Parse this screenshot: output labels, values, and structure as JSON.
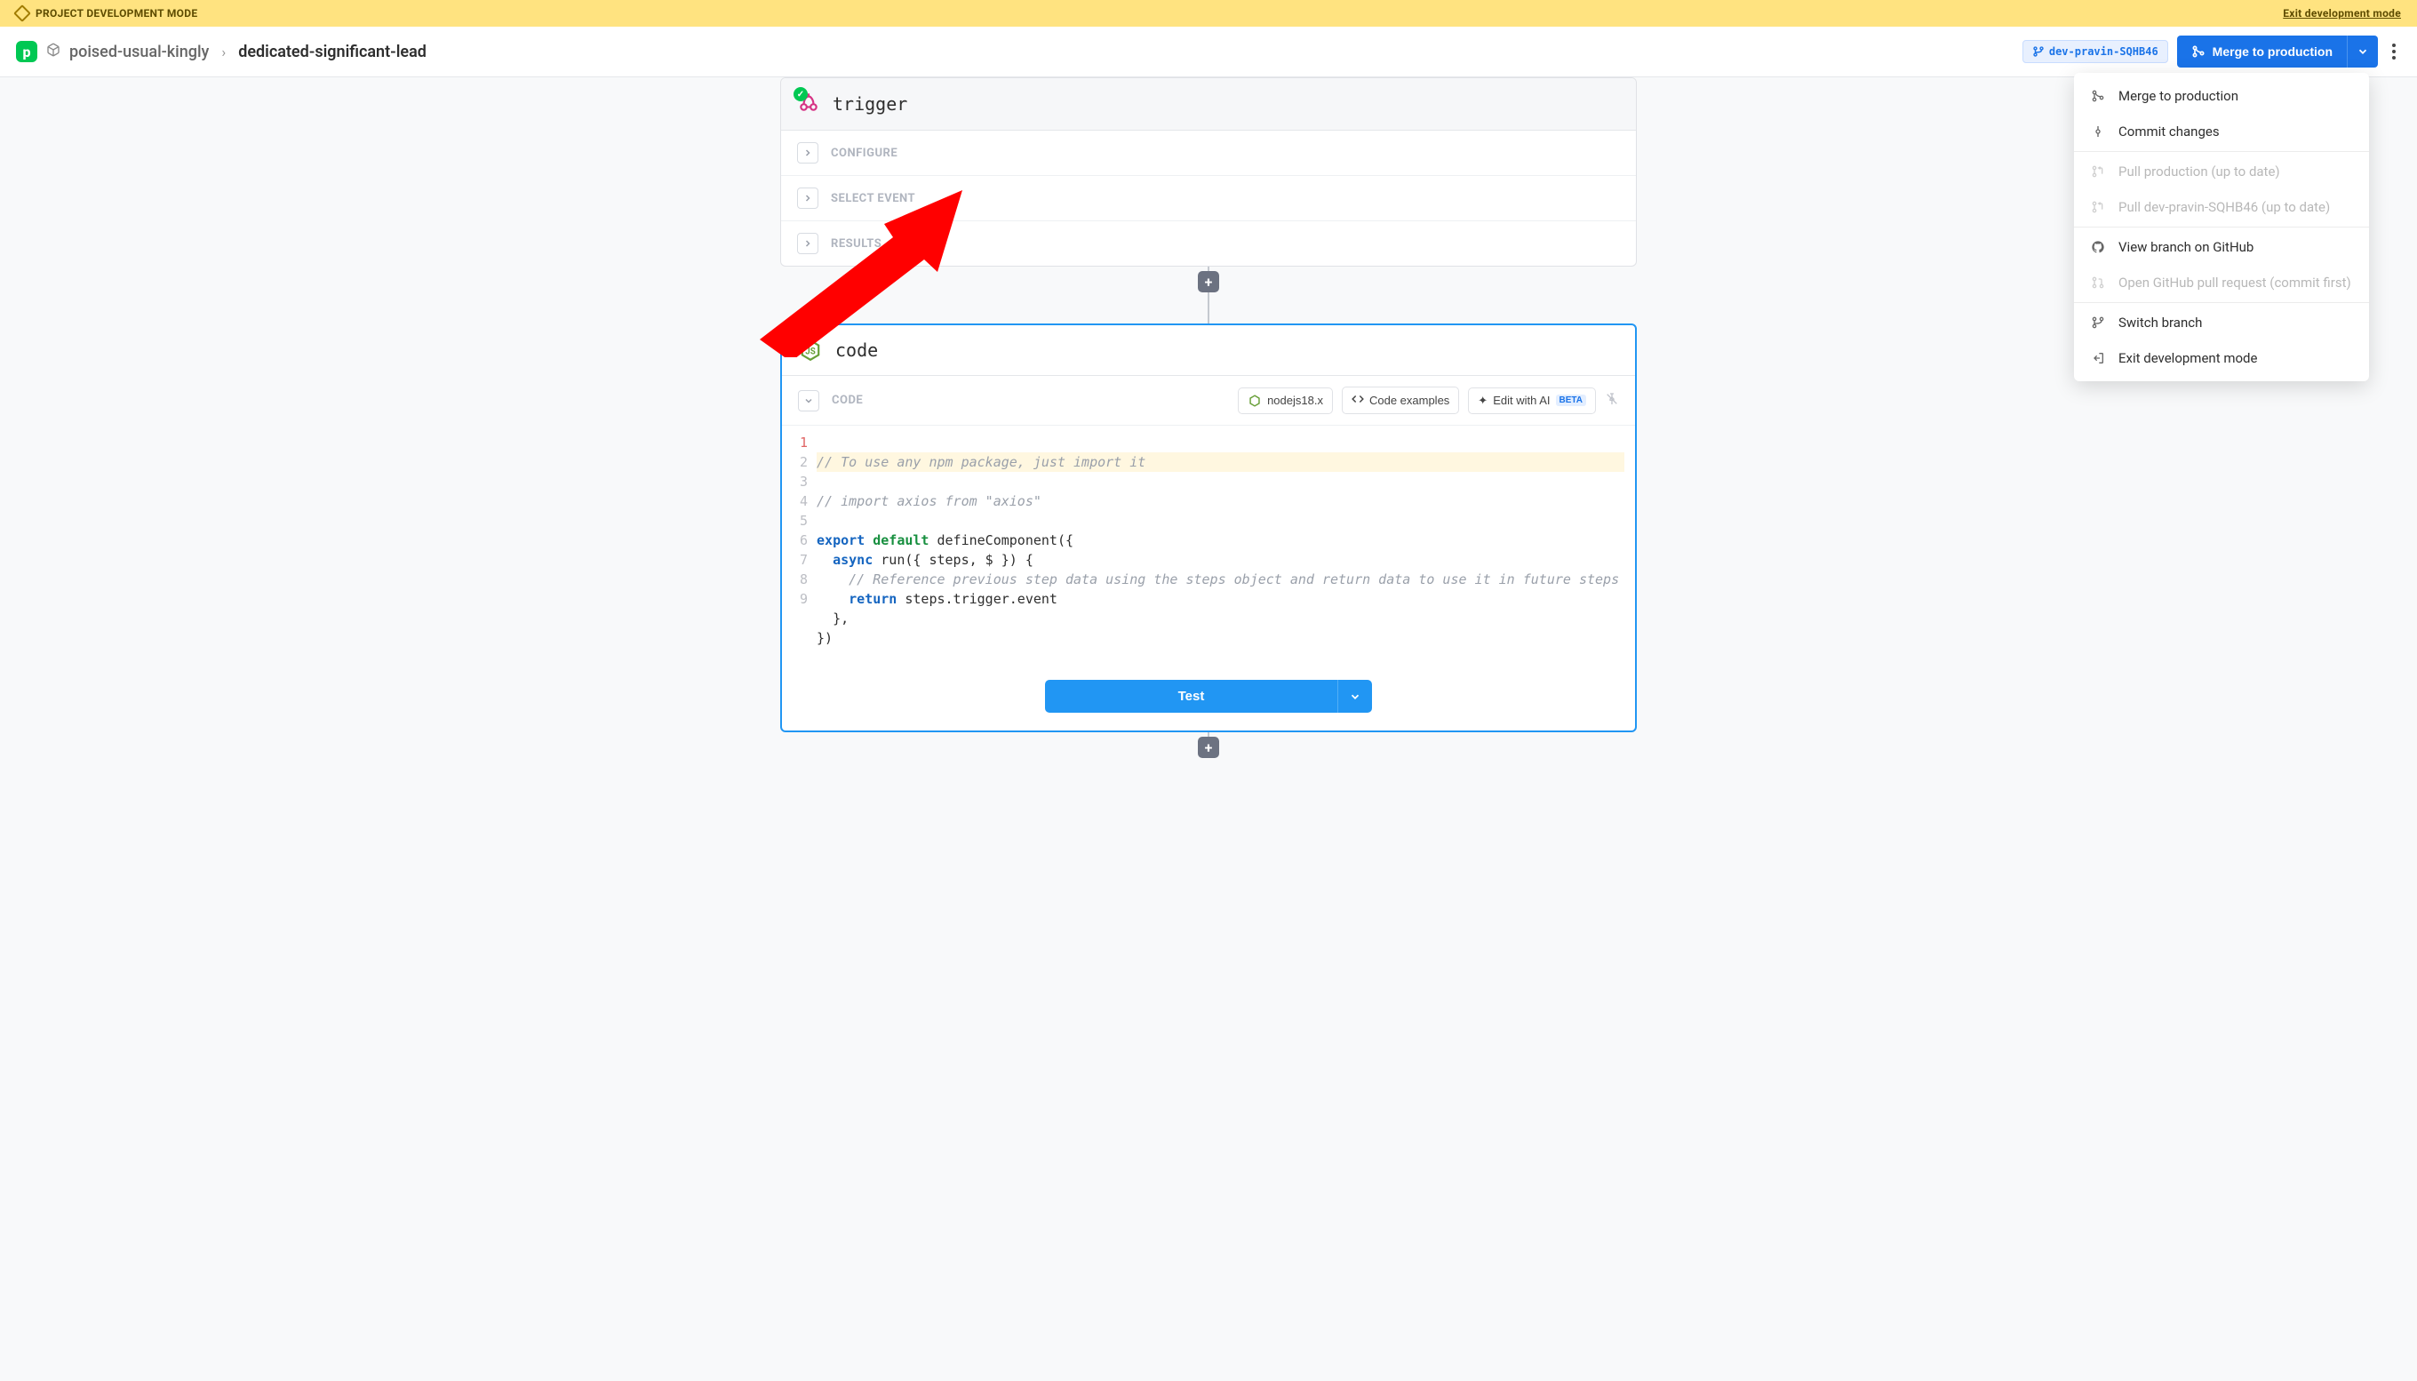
{
  "banner": {
    "mode_label": "PROJECT DEVELOPMENT MODE",
    "exit_label": "Exit development mode"
  },
  "header": {
    "project_name": "poised-usual-kingly",
    "workflow_name": "dedicated-significant-lead",
    "branch_name": "dev-pravin-SQHB46",
    "merge_label": "Merge to production"
  },
  "dropdown": {
    "merge": "Merge to production",
    "commit": "Commit changes",
    "pull_prod": "Pull production (up to date)",
    "pull_branch": "Pull dev-pravin-SQHB46 (up to date)",
    "view_github": "View branch on GitHub",
    "open_pr": "Open GitHub pull request (commit first)",
    "switch_branch": "Switch branch",
    "exit_dev": "Exit development mode"
  },
  "trigger": {
    "title": "trigger",
    "configure": "CONFIGURE",
    "select_event": "SELECT EVENT",
    "results": "RESULTS"
  },
  "code_step": {
    "title": "code",
    "section_label": "CODE",
    "runtime": "nodejs18.x",
    "examples": "Code examples",
    "ai_label": "Edit with AI",
    "ai_badge": "BETA",
    "lines": {
      "l1": "// To use any npm package, just import it",
      "l2": "// import axios from \"axios\"",
      "l3": "",
      "l4_a": "export",
      "l4_b": "default",
      "l4_c": " defineComponent({",
      "l5_a": "async",
      "l5_b": " run({ steps, $ }) {",
      "l6": "    // Reference previous step data using the steps object and return data to use it in future steps",
      "l7_a": "return",
      "l7_b": " steps.trigger.event",
      "l8": "  },",
      "l9": "})"
    },
    "line_numbers": [
      "1",
      "2",
      "3",
      "4",
      "5",
      "6",
      "7",
      "8",
      "9"
    ]
  },
  "test": {
    "label": "Test"
  }
}
